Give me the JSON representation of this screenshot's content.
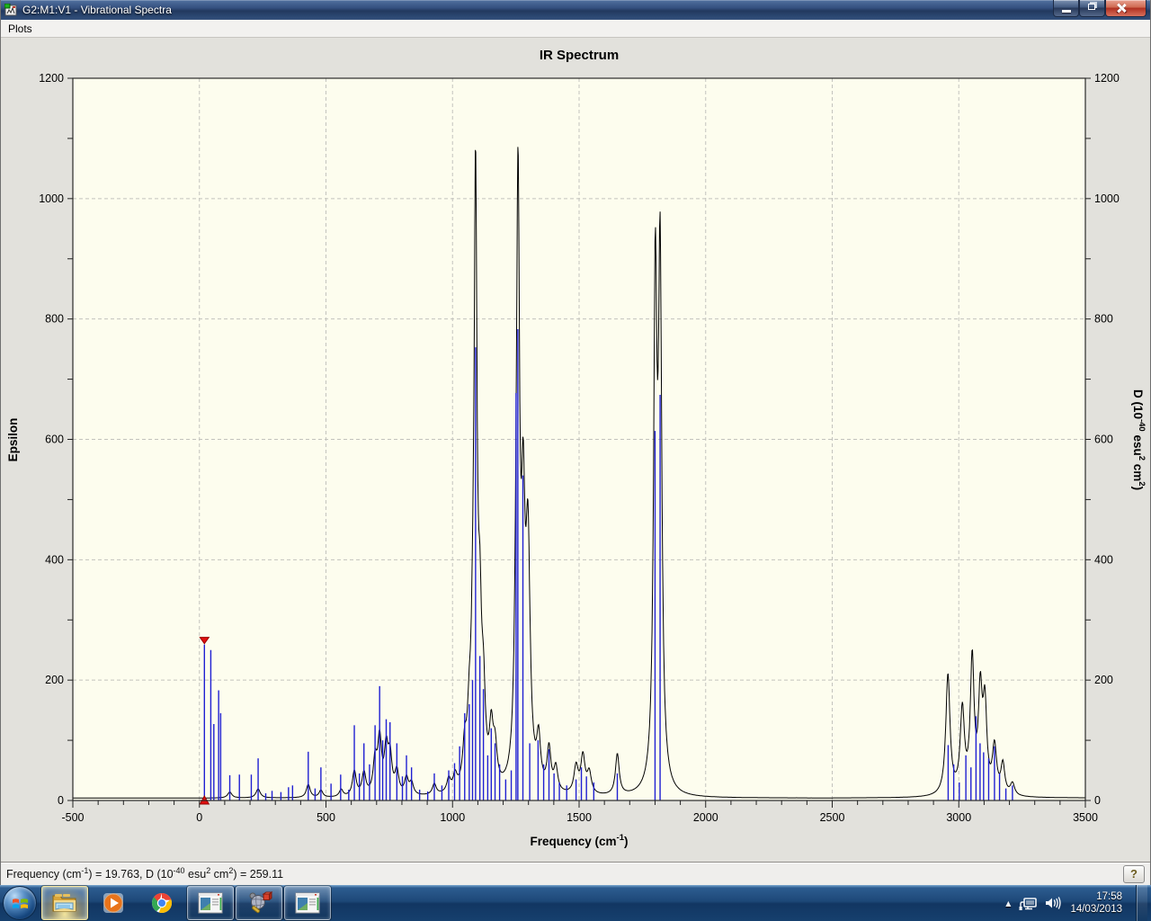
{
  "window": {
    "title": "G2:M1:V1 - Vibrational Spectra",
    "caption_buttons": {
      "minimize": "minimize",
      "restore": "restore",
      "close": "close"
    }
  },
  "menu": {
    "items": [
      "Plots"
    ]
  },
  "chart_data": {
    "type": "line",
    "title": "IR Spectrum",
    "xlabel_segments": [
      {
        "t": "Frequency (cm"
      },
      {
        "sup": "-1"
      },
      {
        "t": ")"
      }
    ],
    "ylabel_left": "Epsilon",
    "ylabel_right_segments": [
      {
        "t": "D (10"
      },
      {
        "sup": "-40"
      },
      {
        "t": " esu"
      },
      {
        "sup": "2"
      },
      {
        "t": " cm"
      },
      {
        "sup": "2"
      },
      {
        "t": ")"
      }
    ],
    "xlim": [
      -500,
      3500
    ],
    "ylim": [
      0,
      1200
    ],
    "x_tick_labels": [
      "-500",
      "0",
      "500",
      "1000",
      "1500",
      "2000",
      "2500",
      "3000",
      "3500"
    ],
    "x_major_step": 500,
    "x_minor_step": 100,
    "y_tick_labels": [
      "0",
      "200",
      "400",
      "600",
      "800",
      "1000",
      "1200"
    ],
    "y_label_step": 200,
    "y_minor_step": 100,
    "grid": true,
    "legend": "none",
    "plot_bg": "#fdfdee",
    "grid_color": "#c3c3bd",
    "frame_color": "#2a2a2a",
    "series": [
      {
        "name": "vibrational line spectrum (sticks)",
        "style": "stick",
        "color": "#1f1fd2",
        "points": [
          [
            19.763,
            259
          ],
          [
            45,
            250
          ],
          [
            57,
            127
          ],
          [
            76,
            183
          ],
          [
            84,
            145
          ],
          [
            120,
            42
          ],
          [
            158,
            43
          ],
          [
            205,
            43
          ],
          [
            232,
            70
          ],
          [
            262,
            12
          ],
          [
            287,
            16
          ],
          [
            322,
            14
          ],
          [
            352,
            22
          ],
          [
            368,
            25
          ],
          [
            430,
            81
          ],
          [
            457,
            20
          ],
          [
            480,
            55
          ],
          [
            520,
            28
          ],
          [
            558,
            43
          ],
          [
            590,
            18
          ],
          [
            612,
            125
          ],
          [
            632,
            45
          ],
          [
            650,
            95
          ],
          [
            672,
            60
          ],
          [
            694,
            125
          ],
          [
            712,
            190
          ],
          [
            724,
            100
          ],
          [
            738,
            135
          ],
          [
            753,
            130
          ],
          [
            780,
            95
          ],
          [
            802,
            40
          ],
          [
            818,
            75
          ],
          [
            838,
            55
          ],
          [
            870,
            18
          ],
          [
            902,
            15
          ],
          [
            928,
            45
          ],
          [
            958,
            25
          ],
          [
            985,
            50
          ],
          [
            1008,
            62
          ],
          [
            1028,
            90
          ],
          [
            1048,
            145
          ],
          [
            1066,
            160
          ],
          [
            1079,
            200
          ],
          [
            1091,
            753
          ],
          [
            1108,
            240
          ],
          [
            1122,
            185
          ],
          [
            1139,
            75
          ],
          [
            1153,
            120
          ],
          [
            1168,
            95
          ],
          [
            1186,
            60
          ],
          [
            1210,
            35
          ],
          [
            1232,
            50
          ],
          [
            1251,
            677
          ],
          [
            1258,
            783
          ],
          [
            1278,
            540
          ],
          [
            1305,
            95
          ],
          [
            1338,
            100
          ],
          [
            1360,
            60
          ],
          [
            1381,
            85
          ],
          [
            1401,
            45
          ],
          [
            1422,
            30
          ],
          [
            1451,
            25
          ],
          [
            1488,
            35
          ],
          [
            1509,
            55
          ],
          [
            1529,
            40
          ],
          [
            1558,
            30
          ],
          [
            1651,
            45
          ],
          [
            1800,
            614
          ],
          [
            1820,
            674
          ],
          [
            2958,
            92
          ],
          [
            2980,
            60
          ],
          [
            3002,
            30
          ],
          [
            3028,
            75
          ],
          [
            3048,
            55
          ],
          [
            3068,
            140
          ],
          [
            3084,
            95
          ],
          [
            3098,
            80
          ],
          [
            3118,
            70
          ],
          [
            3141,
            90
          ],
          [
            3161,
            45
          ],
          [
            3186,
            20
          ],
          [
            3212,
            25
          ]
        ]
      },
      {
        "name": "broadened IR spectrum (Lorentzian envelope)",
        "style": "envelope",
        "color": "#000000",
        "baseline": 4,
        "peaks": [
          [
            120,
            10,
            10
          ],
          [
            232,
            15,
            10
          ],
          [
            430,
            22,
            9
          ],
          [
            480,
            12,
            9
          ],
          [
            560,
            12,
            9
          ],
          [
            612,
            42,
            9
          ],
          [
            650,
            38,
            9
          ],
          [
            694,
            55,
            9
          ],
          [
            712,
            90,
            9
          ],
          [
            738,
            72,
            9
          ],
          [
            753,
            60,
            9
          ],
          [
            780,
            38,
            9
          ],
          [
            818,
            28,
            9
          ],
          [
            838,
            20,
            9
          ],
          [
            928,
            18,
            9
          ],
          [
            985,
            22,
            9
          ],
          [
            1010,
            25,
            9
          ],
          [
            1048,
            60,
            9
          ],
          [
            1066,
            85,
            9
          ],
          [
            1080,
            130,
            8
          ],
          [
            1091,
            980,
            7
          ],
          [
            1108,
            215,
            8
          ],
          [
            1122,
            130,
            9
          ],
          [
            1153,
            90,
            9
          ],
          [
            1168,
            60,
            9
          ],
          [
            1252,
            200,
            8
          ],
          [
            1259,
            880,
            7
          ],
          [
            1279,
            400,
            9
          ],
          [
            1298,
            380,
            10
          ],
          [
            1340,
            78,
            9
          ],
          [
            1381,
            70,
            9
          ],
          [
            1408,
            40,
            9
          ],
          [
            1488,
            45,
            10
          ],
          [
            1515,
            62,
            10
          ],
          [
            1540,
            35,
            10
          ],
          [
            1651,
            68,
            9
          ],
          [
            1801,
            820,
            8
          ],
          [
            1820,
            850,
            8
          ],
          [
            2957,
            200,
            10
          ],
          [
            3014,
            138,
            10
          ],
          [
            3053,
            220,
            9
          ],
          [
            3085,
            160,
            9
          ],
          [
            3103,
            140,
            9
          ],
          [
            3141,
            78,
            10
          ],
          [
            3174,
            50,
            9
          ],
          [
            3212,
            20,
            10
          ]
        ]
      }
    ],
    "selected_peak": {
      "frequency": 19.763,
      "D": 259.11,
      "marker_color": "#e01010"
    }
  },
  "status_bar": {
    "segments": [
      {
        "t": "Frequency (cm"
      },
      {
        "sup": "-1"
      },
      {
        "t": ") = 19.763, D (10"
      },
      {
        "sup": "-40"
      },
      {
        "t": " esu"
      },
      {
        "sup": "2"
      },
      {
        "t": " cm"
      },
      {
        "sup": "2"
      },
      {
        "t": ") = 259.11"
      }
    ],
    "help_label": "?"
  },
  "taskbar": {
    "icons": [
      {
        "id": "windows-explorer",
        "state": "running-hot"
      },
      {
        "id": "windows-media-player",
        "state": "pinned"
      },
      {
        "id": "google-chrome",
        "state": "pinned"
      },
      {
        "id": "app-window-1",
        "state": "running"
      },
      {
        "id": "gaussview",
        "state": "running"
      },
      {
        "id": "app-window-2",
        "state": "running"
      }
    ],
    "tray": {
      "hidden_icons_arrow": "▲",
      "time": "17:58",
      "date": "14/03/2013"
    }
  }
}
